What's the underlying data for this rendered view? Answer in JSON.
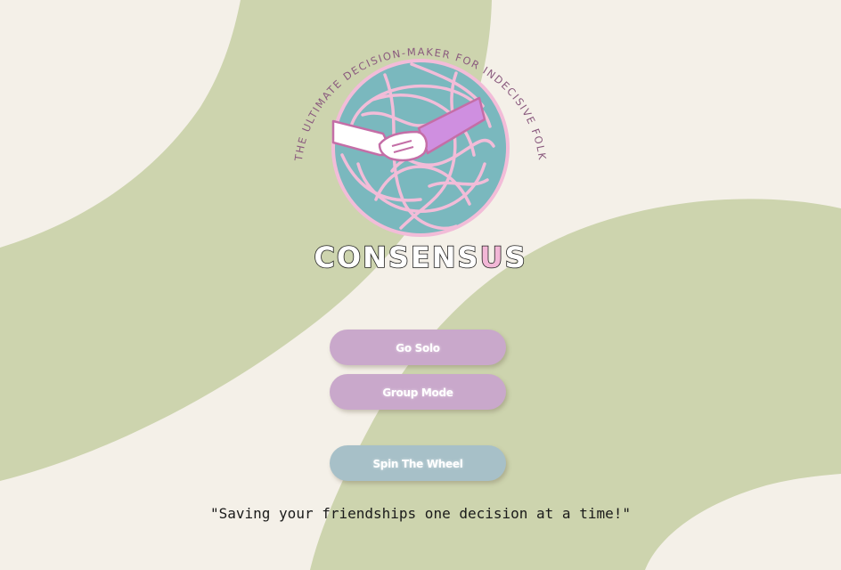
{
  "logo": {
    "arc_text": "THE ULTIMATE DECISION-MAKER FOR INDECISIVE FOLK",
    "brand_prefix": "CONSENS",
    "brand_highlight": "U",
    "brand_suffix": "S"
  },
  "buttons": {
    "solo_label": "Go Solo",
    "group_label": "Group Mode",
    "spin_label": "Spin The Wheel"
  },
  "tagline": "\"Saving your friendships one decision at a time!\"",
  "colors": {
    "background": "#f4f0e8",
    "swoosh": "#cdd4ae",
    "button_purple": "#c9a8cb",
    "button_blue": "#a7c0c8",
    "knot_teal": "#7ab8be",
    "knot_outline": "#f2bcd8",
    "sleeve_purple": "#cf8fe0"
  }
}
